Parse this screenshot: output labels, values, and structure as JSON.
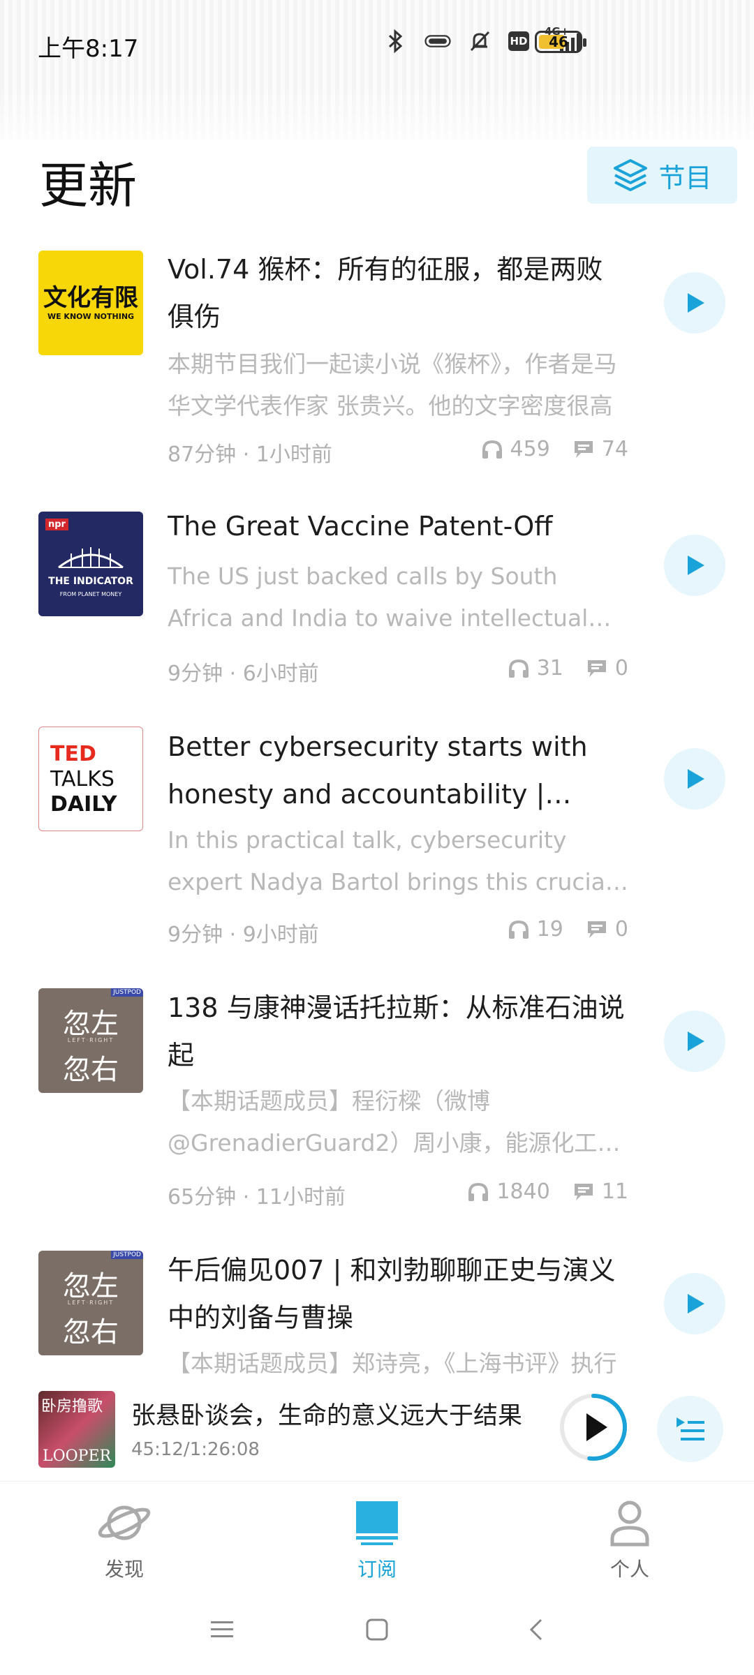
{
  "status_bar": {
    "time": "上午8:17",
    "icons": [
      "bluetooth-icon",
      "pill-icon",
      "mute-bell-icon",
      "hd-icon",
      "signal-4g-icon"
    ],
    "hd_text": "HD",
    "network_text": "4G+",
    "battery": "46"
  },
  "header": {
    "title": "更新",
    "programs_button": "节目"
  },
  "colors": {
    "accent": "#1aa3d8",
    "accent_light": "#e6f6fc",
    "text_primary": "#1d1d1d",
    "text_secondary": "#b8b8b8"
  },
  "feed": [
    {
      "cover_text": "文化有限",
      "cover_sub": "WE KNOW NOTHING",
      "title": "Vol.74 猴杯：所有的征服，都是两败俱伤",
      "desc": "本期节目我们一起读小说《猴杯》，作者是马华文学代表作家 张贵兴。他的文字密度很高",
      "duration": "87分钟",
      "time_ago": "1小时前",
      "plays": "459",
      "comments": "74"
    },
    {
      "cover_text": "THE INDICATOR",
      "cover_sub": "FROM PLANET MONEY",
      "cover_badge": "npr",
      "title": "The Great Vaccine Patent-Off",
      "desc": "The US just backed calls by South Africa and India to waive intellectual property rights",
      "duration": "9分钟",
      "time_ago": "6小时前",
      "plays": "31",
      "comments": "0"
    },
    {
      "cover_line1": "TED",
      "cover_line2": "TALKS",
      "cover_line3": "DAILY",
      "title": "Better cybersecurity starts with honesty and accountability | Nadya Bartol",
      "desc": "In this practical talk, cybersecurity expert Nadya Bartol brings this crucial issue",
      "duration": "9分钟",
      "time_ago": "9小时前",
      "plays": "19",
      "comments": "0"
    },
    {
      "cover_top": "忽左",
      "cover_mid": "LEFT·RIGHT",
      "cover_bottom": "忽右",
      "cover_badge": "JUSTPOD",
      "title": "138 与康神漫话托拉斯：从标准石油说起",
      "desc": "【本期话题成员】程衍樑（微博@GrenadierGuard2）周小康，能源化工从业者",
      "duration": "65分钟",
      "time_ago": "11小时前",
      "plays": "1840",
      "comments": "11"
    },
    {
      "cover_top": "忽左",
      "cover_mid": "LEFT·RIGHT",
      "cover_bottom": "忽右",
      "cover_badge": "JUSTPOD",
      "title": "午后偏见007 | 和刘勃聊聊正史与演义中的刘备与曹操",
      "desc": "【本期话题成员】郑诗亮，《上海书评》执行主编"
    }
  ],
  "mini_player": {
    "cover_text_top": "卧房撸歌",
    "cover_text_bottom": "LOOPER",
    "title": "张悬卧谈会，生命的意义远大于结果",
    "time": "45:12/1:26:08",
    "progress": 0.52
  },
  "bottom_nav": {
    "tabs": [
      {
        "label": "发现",
        "icon": "planet-icon"
      },
      {
        "label": "订阅",
        "icon": "subscribe-icon"
      },
      {
        "label": "个人",
        "icon": "person-icon"
      }
    ],
    "active": "订阅"
  },
  "system_nav": [
    "menu-icon",
    "home-icon",
    "back-icon"
  ]
}
